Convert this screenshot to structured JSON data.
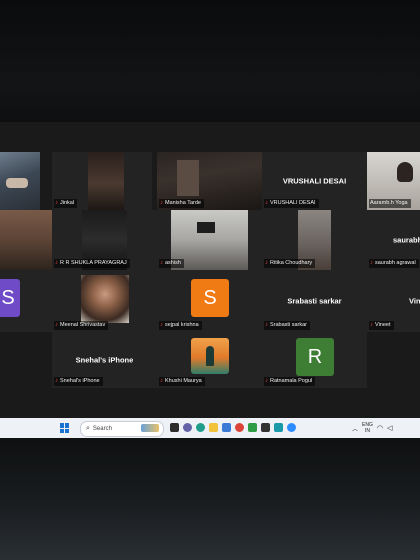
{
  "meeting": {
    "participants": [
      {
        "id": "p1",
        "name": "",
        "muted": false
      },
      {
        "id": "p2",
        "name": "Jinkal",
        "muted": true
      },
      {
        "id": "p3",
        "name": "Manisha Tarde",
        "muted": true
      },
      {
        "id": "p4",
        "name": "VRUSHALI  DESAI",
        "muted": true,
        "big_name": "VRUSHALI  DESAI"
      },
      {
        "id": "p5",
        "name": "Aaramb.h Yoga",
        "muted": false,
        "active": true
      },
      {
        "id": "p6",
        "name": "",
        "muted": false
      },
      {
        "id": "p7",
        "name": "R R SHUKLA  PRAYAGRAJ",
        "muted": true
      },
      {
        "id": "p8",
        "name": "ashish",
        "muted": true
      },
      {
        "id": "p9",
        "name": "Ritika Choudhary",
        "muted": true
      },
      {
        "id": "p10",
        "name": "saurabh agrawal",
        "muted": true,
        "big_name": "saurabh"
      },
      {
        "id": "p11",
        "name": "",
        "muted": false,
        "avatar_letter": "S"
      },
      {
        "id": "p12",
        "name": "Meenal Shrivastav",
        "muted": true
      },
      {
        "id": "p13",
        "name": "sejpal krishna",
        "muted": true,
        "avatar_letter": "S"
      },
      {
        "id": "p14",
        "name": "Srabasti sarkar",
        "muted": true,
        "big_name": "Srabasti sarkar"
      },
      {
        "id": "p15",
        "name": "Vineet",
        "muted": true,
        "big_name": "Vin"
      },
      {
        "id": "p16",
        "name": "Snehal's iPhone",
        "muted": true,
        "big_name": "Snehal's iPhone"
      },
      {
        "id": "p17",
        "name": "Khushi Maurya",
        "muted": true
      },
      {
        "id": "p18",
        "name": "Ratnamala Pogul",
        "muted": true,
        "avatar_letter": "R"
      }
    ]
  },
  "taskbar": {
    "search_placeholder": "Search",
    "tray_lang_line1": "ENG",
    "tray_lang_line2": "IN"
  },
  "colors": {
    "avatar_purple": "#6f4bc8",
    "avatar_orange": "#f07a14",
    "avatar_green": "#3e7d34",
    "active_border": "#35c25a",
    "muted_mic": "#e04545"
  }
}
